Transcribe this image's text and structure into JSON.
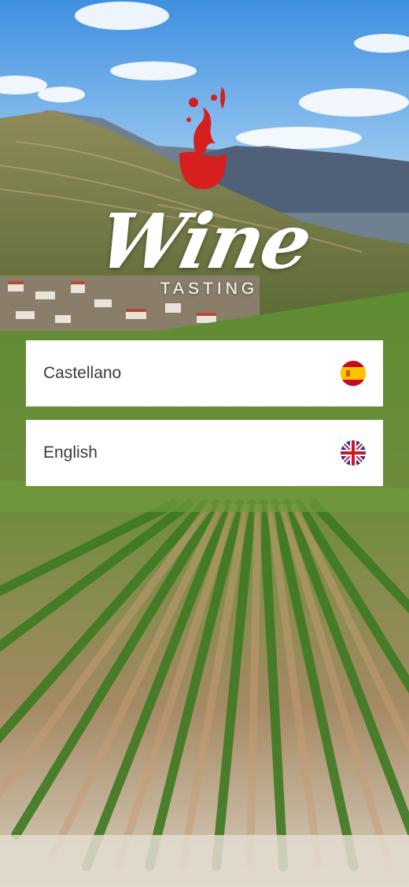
{
  "app": {
    "logo": {
      "title": "Wine",
      "subtitle": "TASTING"
    }
  },
  "languages": [
    {
      "label": "Castellano",
      "flag_icon": "spain-flag-icon"
    },
    {
      "label": "English",
      "flag_icon": "uk-flag-icon"
    }
  ],
  "colors": {
    "wine_red": "#d5201f",
    "button_bg": "#ffffff",
    "label_text": "#3a3a3a"
  }
}
